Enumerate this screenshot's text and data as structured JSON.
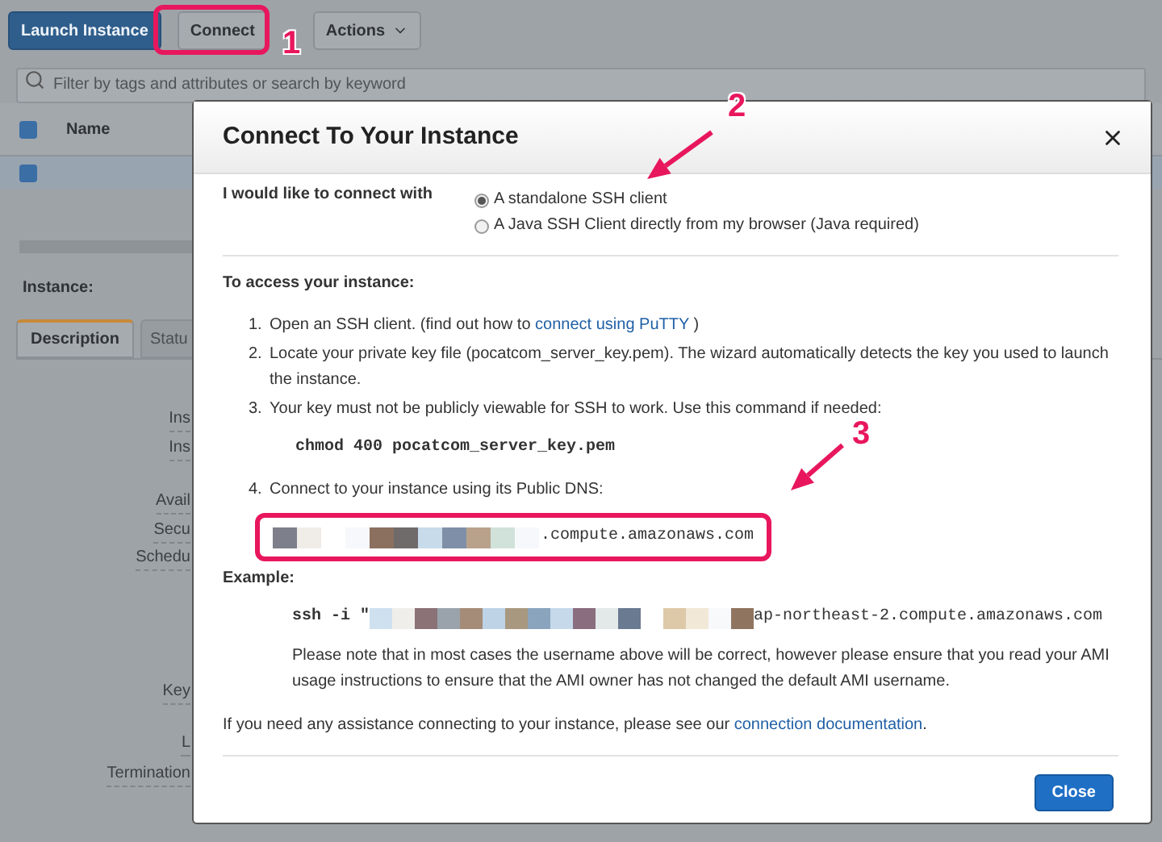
{
  "toolbar": {
    "buttons": [
      {
        "label": "Launch Instance",
        "kind": "primary"
      },
      {
        "label": "Connect",
        "kind": "default"
      },
      {
        "label": "Actions",
        "kind": "dropdown"
      }
    ]
  },
  "search": {
    "placeholder": "Filter by tags and attributes or search by keyword"
  },
  "table": {
    "all_checked": true,
    "columns": [
      "Name"
    ],
    "rows": [
      {
        "selected": true
      }
    ]
  },
  "instance_label": "Instance:",
  "detail_tabs": [
    {
      "label": "Description",
      "selected": true
    },
    {
      "label": "Statu",
      "selected": false
    }
  ],
  "detail_labels": [
    "Ins",
    "Ins",
    "Avail",
    "Secu",
    "Schedu",
    "Key",
    "L",
    "Termination"
  ],
  "dialog": {
    "title": "Connect To Your Instance",
    "prompt": "I would like to connect with",
    "options": [
      {
        "label": "A standalone SSH client",
        "selected": true
      },
      {
        "label": "A Java SSH Client directly from my browser (Java required)",
        "selected": false
      }
    ],
    "heading": "To access your instance:",
    "steps": [
      {
        "number": "1.",
        "text": "Open an SSH client. (find out how to",
        "link": "connect using PuTTY",
        "after": ")"
      },
      {
        "number": "2.",
        "text": "Locate your private key file (pocatcom_server_key.pem). The wizard automatically detects the key you used to launch the instance."
      },
      {
        "number": "3.",
        "text": "Your key must not be publicly viewable for SSH to work. Use this command if needed:",
        "code": "chmod 400 pocatcom_server_key.pem"
      },
      {
        "number": "4.",
        "text": "Connect to your instance using its Public DNS:",
        "dns": ".compute.amazonaws.com"
      }
    ],
    "example_heading": "Example:",
    "ssh_prefix": "ssh -i \"",
    "ssh_suffix": "ap-northeast-2.compute.amazonaws.com",
    "note": "Please note that in most cases the username above will be correct, however please ensure that you read your AMI usage instructions to ensure that the AMI owner has not changed the default AMI username.",
    "help": {
      "text": "If you need any assistance connecting to your instance, please see our",
      "link": "connection documentation",
      "after": "."
    },
    "close_button": "Close"
  },
  "annotations": [
    {
      "label": "1"
    },
    {
      "label": "2"
    },
    {
      "label": "3"
    }
  ]
}
